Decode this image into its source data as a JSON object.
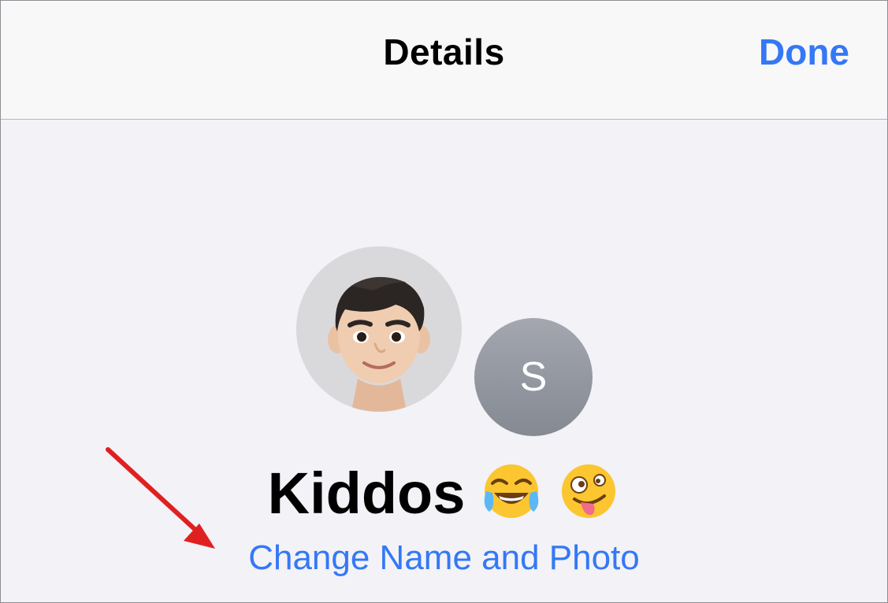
{
  "header": {
    "title": "Details",
    "done_label": "Done"
  },
  "group": {
    "second_member_initial": "S",
    "name": "Kiddos",
    "name_emojis": [
      "face-with-tears-of-joy-emoji",
      "zany-face-emoji"
    ],
    "change_link_label": "Change Name and Photo"
  },
  "colors": {
    "accent": "#3478f6",
    "background": "#f2f2f7",
    "navbar": "#f8f8f8",
    "annotation_arrow": "#e02020",
    "initial_avatar": "#8e9199"
  },
  "icons": {
    "first_member_avatar": "memoji-avatar-icon",
    "annotation": "red-arrow-annotation"
  }
}
